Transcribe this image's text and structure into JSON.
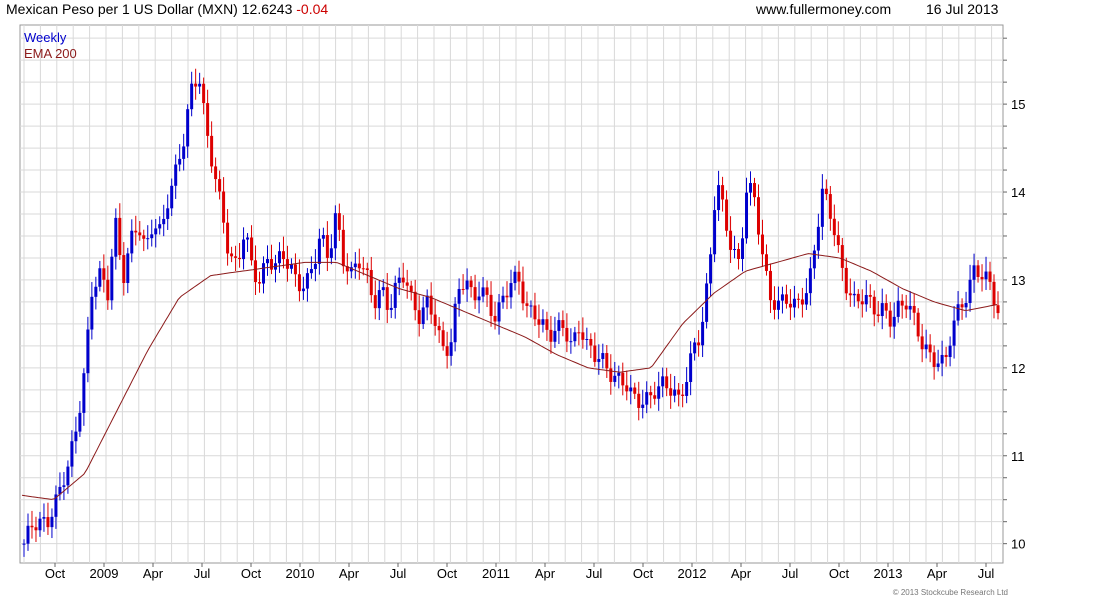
{
  "header": {
    "instrument": "Mexican Peso per 1 US Dollar (MXN)",
    "last": "12.6243",
    "change": "-0.04",
    "site": "www.fullermoney.com",
    "date": "16 Jul 2013"
  },
  "legend": {
    "period": "Weekly",
    "ema": "EMA 200"
  },
  "copyright": "© 2013 Stockcube Research Ltd",
  "colors": {
    "up": "#0000cc",
    "down": "#dd0000",
    "ema": "#8b1a1a",
    "grid": "#d9d9d9"
  },
  "chart_data": {
    "type": "candlestick",
    "title": "Mexican Peso per 1 US Dollar (MXN)",
    "period": "Weekly",
    "y_ticks": [
      10,
      11,
      12,
      13,
      14,
      15
    ],
    "ylim": [
      9.78,
      15.9
    ],
    "x_ticks": [
      "Oct",
      "2009",
      "Apr",
      "Jul",
      "Oct",
      "2010",
      "Apr",
      "Jul",
      "Oct",
      "2011",
      "Apr",
      "Jul",
      "Oct",
      "2012",
      "Apr",
      "Jul",
      "Oct",
      "2013",
      "Apr",
      "Jul"
    ],
    "grid": true,
    "legend_position": "top-left",
    "close_series": [
      10.0,
      10.15,
      10.2,
      10.25,
      10.5,
      10.7,
      10.9,
      11.3,
      12.0,
      13.0,
      13.1,
      12.8,
      13.6,
      13.0,
      13.5,
      13.7,
      13.3,
      13.6,
      13.5,
      14.0,
      14.3,
      14.6,
      15.1,
      15.3,
      14.7,
      14.3,
      13.8,
      13.2,
      13.1,
      13.6,
      13.2,
      13.0,
      13.2,
      13.1,
      13.3,
      13.2,
      13.0,
      12.9,
      13.1,
      13.5,
      13.3,
      13.8,
      13.2,
      13.0,
      13.2,
      13.1,
      12.8,
      12.9,
      12.6,
      12.9,
      13.1,
      12.8,
      12.6,
      12.7,
      12.5,
      12.2,
      12.3,
      12.9,
      13.0,
      12.7,
      12.9,
      12.8,
      12.6,
      12.8,
      12.9,
      13.0,
      12.7,
      12.7,
      12.5,
      12.3,
      12.4,
      12.5,
      12.3,
      12.5,
      12.2,
      12.1,
      12.1,
      12.0,
      11.9,
      11.8,
      11.6,
      11.6,
      11.7,
      11.8,
      11.8,
      11.7,
      11.6,
      11.9,
      12.3,
      12.4,
      13.0,
      14.1,
      13.8,
      13.4,
      13.2,
      14.0,
      13.9,
      13.3,
      12.9,
      12.7,
      12.8,
      12.6,
      12.8,
      12.9,
      13.5,
      14.0,
      13.7,
      13.3,
      13.0,
      12.8,
      12.8,
      12.7,
      12.6,
      12.7,
      12.6,
      12.7,
      12.7,
      12.5,
      12.3,
      12.2,
      12.1,
      12.0,
      12.4,
      12.7,
      12.9,
      13.2,
      13.0,
      12.9,
      12.6
    ],
    "ema_200_series": [
      10.55,
      10.5,
      10.8,
      11.5,
      12.2,
      12.8,
      13.05,
      13.1,
      13.15,
      13.2,
      13.2,
      13.05,
      12.9,
      12.8,
      12.65,
      12.5,
      12.35,
      12.15,
      12.0,
      11.95,
      12.0,
      12.5,
      12.85,
      13.1,
      13.2,
      13.3,
      13.25,
      13.1,
      12.9,
      12.75,
      12.65,
      12.72
    ],
    "last_close": 12.6243
  }
}
